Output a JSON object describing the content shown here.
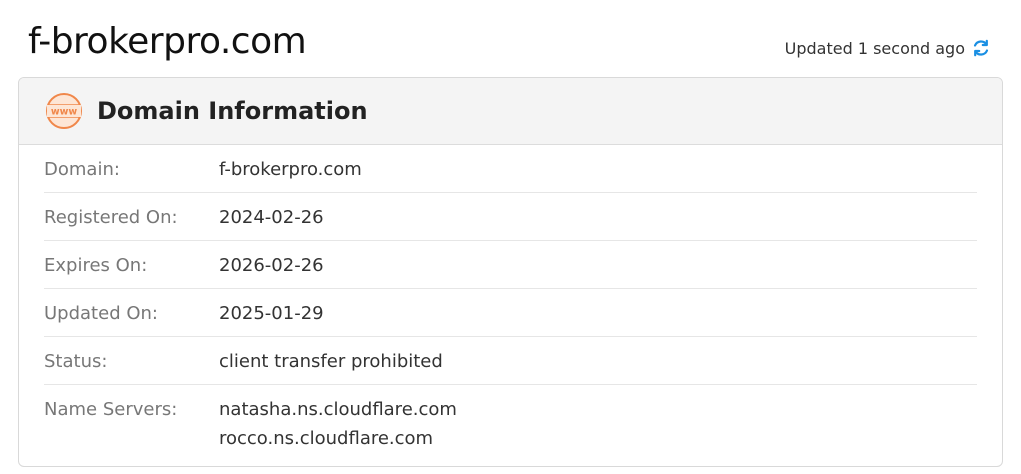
{
  "header": {
    "domain_title": "f-brokerpro.com",
    "updated_text": "Updated 1 second ago",
    "refresh_icon": "refresh-icon"
  },
  "card": {
    "icon": "www-icon",
    "icon_text": "www",
    "title": "Domain Information",
    "rows": [
      {
        "label": "Domain:",
        "value": "f-brokerpro.com"
      },
      {
        "label": "Registered On:",
        "value": "2024-02-26"
      },
      {
        "label": "Expires On:",
        "value": "2026-02-26"
      },
      {
        "label": "Updated On:",
        "value": "2025-01-29"
      },
      {
        "label": "Status:",
        "value": "client transfer prohibited"
      },
      {
        "label": "Name Servers:",
        "values": [
          "natasha.ns.cloudflare.com",
          "rocco.ns.cloudflare.com"
        ]
      }
    ]
  },
  "colors": {
    "accent_orange": "#f0874a",
    "refresh_blue": "#1a8fe3"
  }
}
